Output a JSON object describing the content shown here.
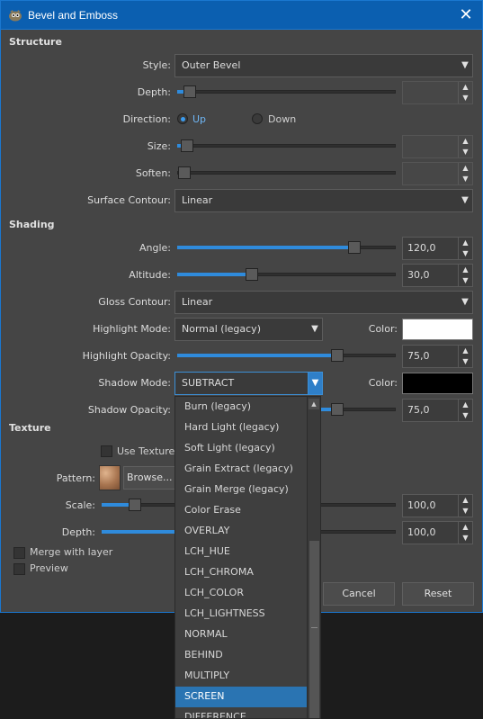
{
  "window": {
    "title": "Bevel and Emboss",
    "close_glyph": "✕"
  },
  "structure": {
    "heading": "Structure",
    "style": {
      "label": "Style:",
      "value": "Outer Bevel"
    },
    "depth": {
      "label": "Depth:",
      "value": "",
      "level": 0.02
    },
    "direction": {
      "label": "Direction:",
      "options": [
        "Up",
        "Down"
      ],
      "selected": "Up"
    },
    "size": {
      "label": "Size:",
      "value": "",
      "level": 0.0
    },
    "soften": {
      "label": "Soften:",
      "value": "",
      "level": 0.0
    },
    "surface_contour": {
      "label": "Surface Contour:",
      "value": "Linear"
    }
  },
  "shading": {
    "heading": "Shading",
    "angle": {
      "label": "Angle:",
      "value": "120,0",
      "level": 0.82
    },
    "altitude": {
      "label": "Altitude:",
      "value": "30,0",
      "level": 0.33
    },
    "gloss_contour": {
      "label": "Gloss Contour:",
      "value": "Linear"
    },
    "highlight_mode": {
      "label": "Highlight Mode:",
      "value": "Normal (legacy)",
      "color_label": "Color:",
      "color": "#ffffff"
    },
    "highlight_opacity": {
      "label": "Highlight Opacity:",
      "value": "75,0",
      "level": 0.75
    },
    "shadow_mode": {
      "label": "Shadow Mode:",
      "value": "SUBTRACT",
      "color_label": "Color:",
      "color": "#000000"
    },
    "shadow_opacity": {
      "label": "Shadow Opacity:",
      "value": "75,0",
      "level": 0.75
    }
  },
  "texture": {
    "heading": "Texture",
    "use_texture_label": "Use Texture",
    "pattern_label": "Pattern:",
    "browse_label": "Browse...",
    "scale": {
      "label": "Scale:",
      "value": "100,0"
    },
    "depth": {
      "label": "Depth:",
      "value": "100,0"
    }
  },
  "merge_with_layer_label": "Merge with layer",
  "preview_label": "Preview",
  "buttons": {
    "cancel": "Cancel",
    "reset": "Reset"
  },
  "dropdown": {
    "items": [
      "Burn (legacy)",
      "Hard Light (legacy)",
      "Soft Light (legacy)",
      "Grain Extract (legacy)",
      "Grain Merge (legacy)",
      "Color Erase",
      "OVERLAY",
      "LCH_HUE",
      "LCH_CHROMA",
      "LCH_COLOR",
      "LCH_LIGHTNESS",
      "NORMAL",
      "BEHIND",
      "MULTIPLY",
      "SCREEN",
      "DIFFERENCE"
    ],
    "selected": "SCREEN"
  },
  "colors": {
    "accent": "#2f8bdc",
    "titlebar": "#0b5fb0",
    "panel": "#454545"
  }
}
